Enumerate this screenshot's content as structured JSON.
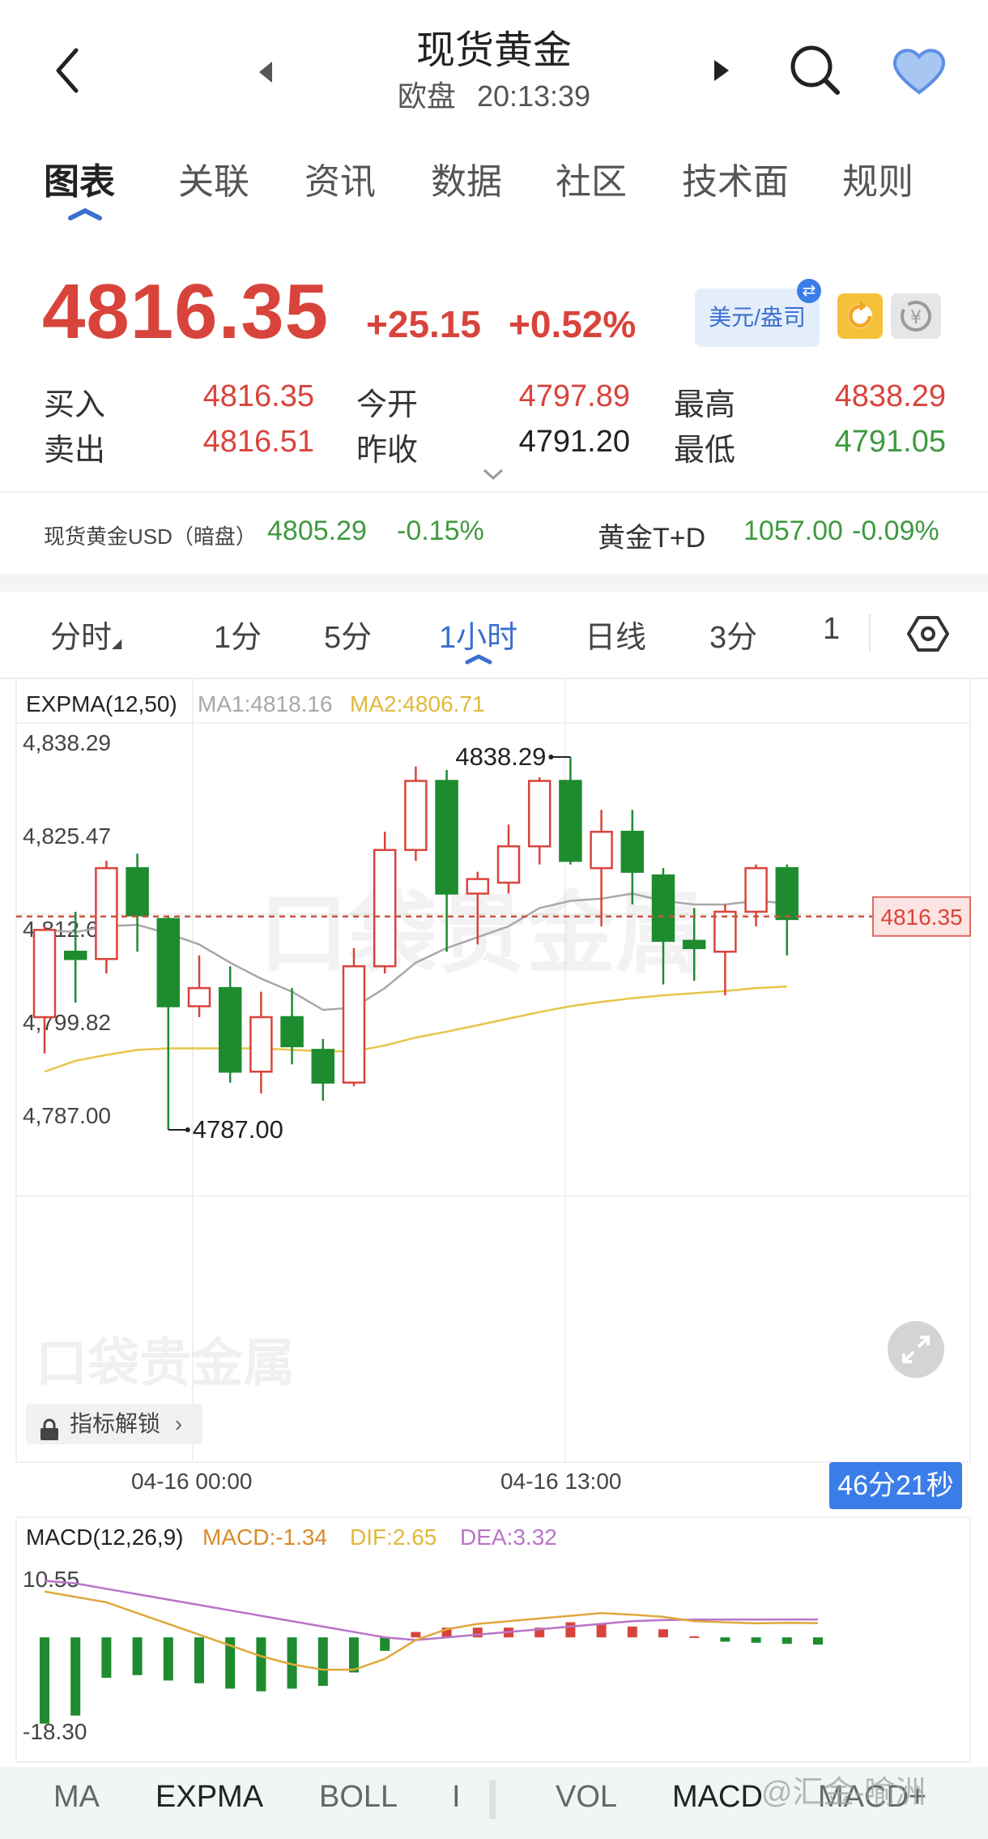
{
  "header": {
    "title": "现货黄金",
    "market": "欧盘",
    "time": "20:13:39"
  },
  "tabs": [
    "图表",
    "关联",
    "资讯",
    "数据",
    "社区",
    "技术面",
    "规则"
  ],
  "quote": {
    "price": "4816.35",
    "change": "+25.15",
    "change_pct": "+0.52%",
    "currency_button": "美元/盎司",
    "bid_label": "买入",
    "bid": "4816.35",
    "ask_label": "卖出",
    "ask": "4816.51",
    "open_label": "今开",
    "open": "4797.89",
    "prev_close_label": "昨收",
    "prev_close": "4791.20",
    "high_label": "最高",
    "high": "4838.29",
    "low_label": "最低",
    "low": "4791.05"
  },
  "related": {
    "item1_name": "现货黄金USD（暗盘）",
    "item1_price": "4805.29",
    "item1_pct": "-0.15%",
    "item2_name": "黄金T+D",
    "item2_price": "1057.00",
    "item2_pct": "-0.09%"
  },
  "periods": [
    "分时",
    "1分",
    "5分",
    "1小时",
    "日线",
    "3分",
    "1"
  ],
  "colors": {
    "up": "#d8443b",
    "down": "#1e8c2e",
    "ma1": "#a8a8a8",
    "ma2": "#e6c64a",
    "accent": "#3b7de8"
  },
  "chart_data": [
    {
      "type": "candlestick",
      "indicator": "EXPMA(12,50)",
      "ma1_label": "MA1:4818.16",
      "ma2_label": "MA2:4806.71",
      "y_ticks": [
        "4,838.29",
        "4,825.47",
        "4,812.65",
        "4,799.82",
        "4,787.00"
      ],
      "ylim": [
        4787.0,
        4838.29
      ],
      "x_labels": [
        "04-16 00:00",
        "04-16 13:00"
      ],
      "high_marker": "4838.29",
      "low_marker": "4787.00",
      "current_price_label": "4816.35",
      "candles": [
        {
          "o": 4802.5,
          "c": 4814.5,
          "h": 4815.0,
          "l": 4797.5
        },
        {
          "o": 4811.5,
          "c": 4810.5,
          "h": 4817.0,
          "l": 4804.5
        },
        {
          "o": 4810.5,
          "c": 4823.0,
          "h": 4824.0,
          "l": 4808.5
        },
        {
          "o": 4823.0,
          "c": 4816.5,
          "h": 4825.0,
          "l": 4811.5
        },
        {
          "o": 4816.0,
          "c": 4804.0,
          "h": 4816.5,
          "l": 4787.0
        },
        {
          "o": 4804.0,
          "c": 4806.5,
          "h": 4811.0,
          "l": 4802.5
        },
        {
          "o": 4806.5,
          "c": 4795.0,
          "h": 4809.5,
          "l": 4793.5
        },
        {
          "o": 4795.0,
          "c": 4802.5,
          "h": 4806.0,
          "l": 4792.0
        },
        {
          "o": 4802.5,
          "c": 4798.5,
          "h": 4806.5,
          "l": 4796.0
        },
        {
          "o": 4798.0,
          "c": 4793.5,
          "h": 4799.5,
          "l": 4791.0
        },
        {
          "o": 4793.5,
          "c": 4809.5,
          "h": 4812.0,
          "l": 4793.0
        },
        {
          "o": 4809.5,
          "c": 4825.5,
          "h": 4828.0,
          "l": 4808.5
        },
        {
          "o": 4825.5,
          "c": 4835.0,
          "h": 4837.0,
          "l": 4824.0
        },
        {
          "o": 4835.0,
          "c": 4819.5,
          "h": 4836.5,
          "l": 4811.5
        },
        {
          "o": 4819.5,
          "c": 4821.5,
          "h": 4822.5,
          "l": 4812.5
        },
        {
          "o": 4821.0,
          "c": 4826.0,
          "h": 4829.0,
          "l": 4819.5
        },
        {
          "o": 4826.0,
          "c": 4835.0,
          "h": 4835.5,
          "l": 4823.5
        },
        {
          "o": 4835.0,
          "c": 4824.0,
          "h": 4838.29,
          "l": 4823.5
        },
        {
          "o": 4823.0,
          "c": 4828.0,
          "h": 4831.0,
          "l": 4815.0
        },
        {
          "o": 4828.0,
          "c": 4822.5,
          "h": 4831.0,
          "l": 4818.0
        },
        {
          "o": 4822.0,
          "c": 4813.0,
          "h": 4823.0,
          "l": 4807.0
        },
        {
          "o": 4813.0,
          "c": 4812.0,
          "h": 4817.5,
          "l": 4807.5
        },
        {
          "o": 4811.5,
          "c": 4817.0,
          "h": 4818.0,
          "l": 4805.5
        },
        {
          "o": 4817.0,
          "c": 4823.0,
          "h": 4823.5,
          "l": 4815.0
        },
        {
          "o": 4823.0,
          "c": 4816.0,
          "h": 4823.5,
          "l": 4811.0
        }
      ],
      "ma1": [
        4814.5,
        4814.2,
        4815.0,
        4815.2,
        4814.0,
        4812.5,
        4810.0,
        4807.8,
        4806.0,
        4803.5,
        4803.8,
        4806.5,
        4810.0,
        4812.0,
        4813.5,
        4815.0,
        4817.5,
        4818.5,
        4818.8,
        4819.5,
        4818.5,
        4818.0,
        4818.0,
        4818.5,
        4818.16
      ],
      "ma2": [
        4795.0,
        4796.5,
        4797.3,
        4798.0,
        4798.2,
        4798.2,
        4798.2,
        4798.2,
        4798.0,
        4797.8,
        4797.8,
        4798.6,
        4799.7,
        4800.5,
        4801.4,
        4802.3,
        4803.2,
        4804.0,
        4804.6,
        4805.1,
        4805.5,
        4805.8,
        4806.1,
        4806.5,
        4806.71
      ]
    },
    {
      "type": "bar",
      "indicator": "MACD(12,26,9)",
      "macd_label": "MACD:-1.34",
      "dif_label": "DIF:2.65",
      "dea_label": "DEA:3.32",
      "y_ticks": [
        "10.55",
        "-18.30"
      ],
      "ylim": [
        -18.3,
        10.55
      ],
      "histogram": [
        -16.0,
        -14.5,
        -7.5,
        -7.0,
        -8.0,
        -8.5,
        -9.5,
        -10.0,
        -9.5,
        -9.0,
        -6.5,
        -2.5,
        1.0,
        1.8,
        1.8,
        1.8,
        1.8,
        2.8,
        2.6,
        2.0,
        1.5,
        0.2,
        -0.8,
        -1.0,
        -1.2,
        -1.34
      ],
      "dif": [
        8.5,
        7.5,
        6.5,
        4.5,
        2.5,
        0.5,
        -1.5,
        -3.5,
        -5.0,
        -6.0,
        -6.0,
        -4.0,
        -0.5,
        1.5,
        2.5,
        3.0,
        3.5,
        4.0,
        4.5,
        4.2,
        3.8,
        3.0,
        2.8,
        2.6,
        2.7,
        2.65
      ],
      "dea": [
        10.5,
        10.0,
        9.0,
        8.0,
        7.0,
        6.0,
        5.0,
        4.0,
        3.0,
        2.0,
        1.0,
        0.0,
        -0.5,
        0.0,
        0.5,
        1.0,
        1.5,
        2.0,
        2.5,
        3.0,
        3.2,
        3.3,
        3.3,
        3.3,
        3.3,
        3.32
      ]
    }
  ],
  "countdown": "46分21秒",
  "unlock_label": "指标解锁",
  "bottom_tabs": [
    "MA",
    "EXPMA",
    "BOLL",
    "I",
    "VOL",
    "MACD",
    "MACD+"
  ],
  "watermark": "@汇金-喻洲"
}
